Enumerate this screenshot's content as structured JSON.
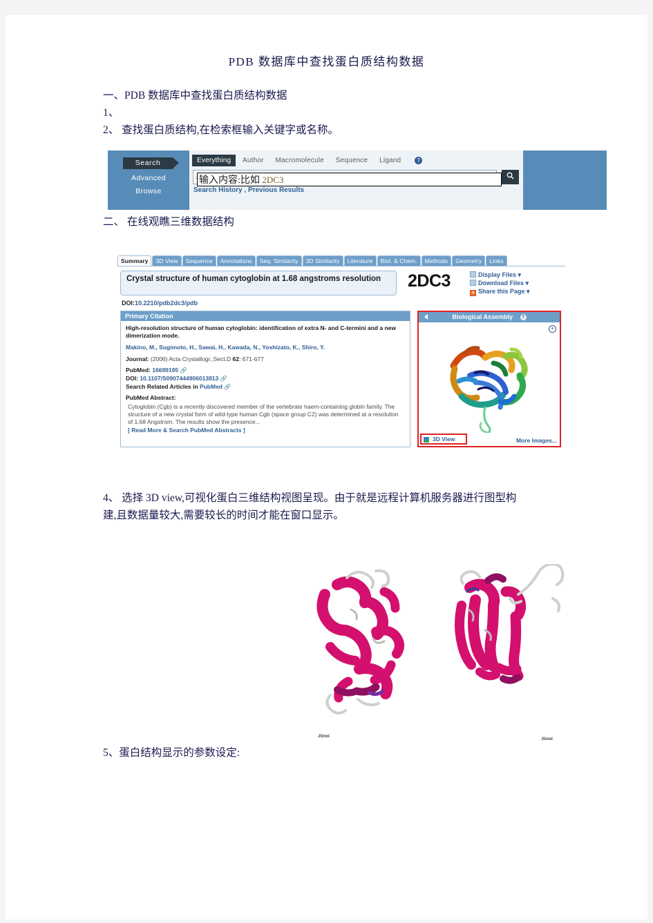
{
  "document": {
    "title": "PDB 数据库中查找蛋白质结构数据",
    "section1": "一、PDB 数据库中查找蛋白质结构数据",
    "item1": "1、",
    "item2": "2、  查找蛋白质结构,在检索框输入关键字或名称。",
    "section2": "二、 在线观瞧三维数据结构",
    "item4_line1": "4、 选择 3D view,可视化蛋白三维结构视图呈现。由于就是远程计算机服务器进行图型构",
    "item4_line2": "建,且数据量较大,需要较长的时间才能在窗口显示。",
    "item5": "5、蛋白结构显示的参数设定:"
  },
  "search_panel": {
    "left_nav": {
      "search_tab": "Search",
      "advanced": "Advanced",
      "browse": "Browse"
    },
    "categories": [
      "Everything",
      "Author",
      "Macromolecule",
      "Sequence",
      "Ligand"
    ],
    "active_category": "Everything",
    "help_icon": "?",
    "search_icon": "⌕",
    "glasses_icon": "∞",
    "input_value": "",
    "history_links": [
      "Search History",
      "Previous Results"
    ],
    "history_separator": " , ",
    "annotation_text": "输入内容:比如 ",
    "annotation_code": "2DC3",
    "colors": {
      "panel_bg": "#588cb8",
      "inner_bg": "#eef3f8",
      "dark_tab": "#2b3a44",
      "link": "#2f5f95"
    }
  },
  "pdb_summary": {
    "tabs": [
      "Summary",
      "3D View",
      "Sequence",
      "Annotations",
      "Seq. Similarity",
      "3D Similarity",
      "Literature",
      "Biol. & Chem.",
      "Methods",
      "Geometry",
      "Links"
    ],
    "active_tab": "Summary",
    "structure_title": "Crystal structure of human cytoglobin at 1.68 angstroms resolution",
    "pdb_id": "2DC3",
    "file_links": [
      "Display Files",
      "Download Files",
      "Share this Page"
    ],
    "doi_label": "DOI:",
    "doi_value": "10.2210/pdb2dc3/pdb",
    "primary_citation": {
      "header": "Primary Citation",
      "title": "High-resolution structure of human cytoglobin: identification of extra N- and C-termini and a new dimerization mode.",
      "authors": "Makino, M., Sugimoto, H., Sawai, H., Kawada, N., Yoshizato, K., Shiro, Y.",
      "journal_label": "Journal:",
      "journal_value": "(2006) Acta Crystallogr.,Sect.D ",
      "journal_volume": "62",
      "journal_pages": ": 671-677",
      "pubmed_label": "PubMed:",
      "pubmed_value": "16699195",
      "doi_label": "DOI:",
      "doi_value": "10.1107/S0907444906013813",
      "related_label": "Search Related Articles in ",
      "related_link": "PubMed",
      "abstract_label": "PubMed Abstract:",
      "abstract_text": "Cytoglobin (Cgb) is a recently discovered member of the vertebrate haem-containing globin family. The structure of a new crystal form of wild-type human Cgb (space group C2) was determined at a resolution of 1.68 Angstrom. The results show the presence...",
      "read_more": "[ Read More & Search PubMed Abstracts ]"
    },
    "biological_assembly": {
      "header": "Biological Assembly",
      "help_icon": "?",
      "expand_icon": "+",
      "view_3d_label": "3D View",
      "more_images_label": "More Images...",
      "highlight_color": "#e02020"
    },
    "colors": {
      "tab_bg": "#6d9fc9",
      "panel_border": "#9fbcd6",
      "link": "#2f5f95",
      "title_bg": "#eaf1f8"
    }
  },
  "jsmol_figures": {
    "watermark_left": "JSmol",
    "watermark_right": "JSmol",
    "ribbon_color": "#d4106e"
  }
}
